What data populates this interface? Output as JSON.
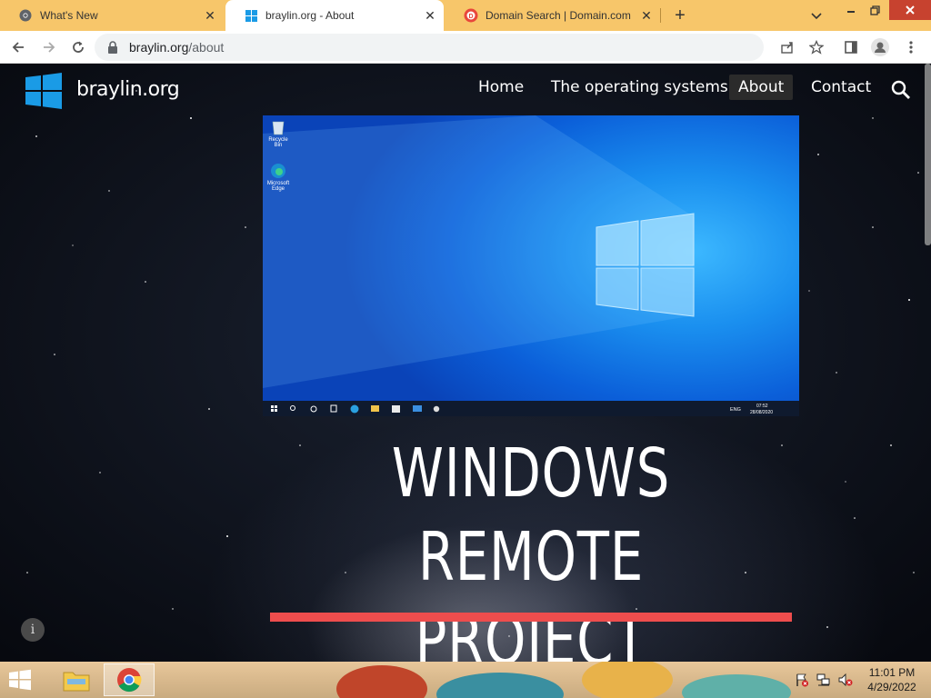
{
  "browser": {
    "tabs": [
      {
        "title": "What's New",
        "icon": "chrome-icon",
        "active": false
      },
      {
        "title": "braylin.org - About",
        "icon": "windows-logo-icon",
        "active": true
      },
      {
        "title": "Domain Search | Domain.com",
        "icon": "domain-com-icon",
        "active": false
      }
    ],
    "url_host": "braylin.org",
    "url_path": "/about",
    "accent": "#f7c66a"
  },
  "site": {
    "name": "braylin.org",
    "nav": [
      "Home",
      "The operating systems",
      "About",
      "Contact"
    ],
    "active_nav": "About",
    "hero_title_line1": "WINDOWS REMOTE",
    "hero_title_line2": "PROJECT",
    "accent_bar_color": "#ee4d4d",
    "screenshot": {
      "desktop_icons": [
        "Recycle Bin",
        "Microsoft Edge"
      ],
      "time": "07:52",
      "date": "28/08/2020",
      "lang": "ENG"
    }
  },
  "taskbar": {
    "time": "11:01 PM",
    "date": "4/29/2022"
  }
}
